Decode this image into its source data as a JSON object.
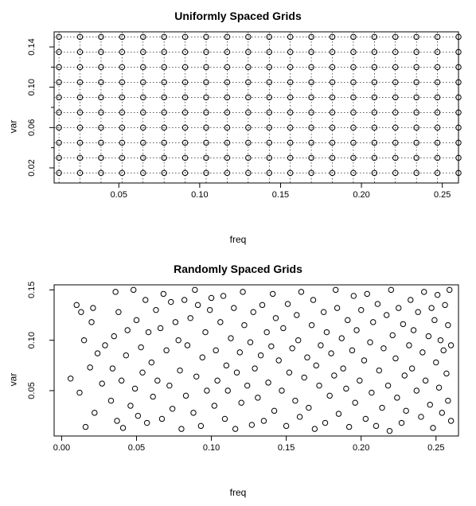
{
  "chart_data": [
    {
      "type": "scatter",
      "title": "Uniformly Spaced Grids",
      "xlabel": "freq",
      "ylabel": "var",
      "xlim": [
        0.01,
        0.26
      ],
      "ylim": [
        0.005,
        0.155
      ],
      "xticks": [
        0.05,
        0.1,
        0.15,
        0.2,
        0.25
      ],
      "yticks_major": [
        0.02,
        0.06,
        0.1,
        0.14
      ],
      "yticks_minor": [
        0.04,
        0.08,
        0.12
      ],
      "grid_x_values": [
        0.013,
        0.026,
        0.039,
        0.052,
        0.065,
        0.078,
        0.091,
        0.104,
        0.117,
        0.13,
        0.143,
        0.156,
        0.169,
        0.182,
        0.195,
        0.208,
        0.221,
        0.234,
        0.247,
        0.26
      ],
      "grid_y_values": [
        0.015,
        0.03,
        0.045,
        0.06,
        0.075,
        0.09,
        0.105,
        0.12,
        0.135,
        0.15
      ],
      "grid": true,
      "note": "points are the full Cartesian product of grid_x_values × grid_y_values (200 points)"
    },
    {
      "type": "scatter",
      "title": "Randomly Spaced Grids",
      "xlabel": "freq",
      "ylabel": "var",
      "xlim": [
        -0.005,
        0.265
      ],
      "ylim": [
        0.005,
        0.155
      ],
      "xticks": [
        0.0,
        0.05,
        0.1,
        0.15,
        0.2,
        0.25
      ],
      "yticks_major": [
        0.05,
        0.1,
        0.15
      ],
      "grid": false,
      "points": [
        [
          0.006,
          0.062
        ],
        [
          0.01,
          0.135
        ],
        [
          0.012,
          0.048
        ],
        [
          0.013,
          0.128
        ],
        [
          0.015,
          0.1
        ],
        [
          0.016,
          0.014
        ],
        [
          0.019,
          0.073
        ],
        [
          0.02,
          0.118
        ],
        [
          0.021,
          0.132
        ],
        [
          0.022,
          0.028
        ],
        [
          0.024,
          0.087
        ],
        [
          0.027,
          0.057
        ],
        [
          0.029,
          0.095
        ],
        [
          0.033,
          0.04
        ],
        [
          0.034,
          0.072
        ],
        [
          0.035,
          0.104
        ],
        [
          0.036,
          0.148
        ],
        [
          0.037,
          0.02
        ],
        [
          0.038,
          0.128
        ],
        [
          0.04,
          0.06
        ],
        [
          0.041,
          0.013
        ],
        [
          0.043,
          0.085
        ],
        [
          0.044,
          0.11
        ],
        [
          0.046,
          0.035
        ],
        [
          0.048,
          0.15
        ],
        [
          0.049,
          0.052
        ],
        [
          0.05,
          0.12
        ],
        [
          0.051,
          0.025
        ],
        [
          0.053,
          0.093
        ],
        [
          0.054,
          0.068
        ],
        [
          0.056,
          0.14
        ],
        [
          0.057,
          0.018
        ],
        [
          0.058,
          0.108
        ],
        [
          0.06,
          0.078
        ],
        [
          0.061,
          0.044
        ],
        [
          0.063,
          0.13
        ],
        [
          0.064,
          0.06
        ],
        [
          0.066,
          0.112
        ],
        [
          0.067,
          0.022
        ],
        [
          0.068,
          0.146
        ],
        [
          0.07,
          0.09
        ],
        [
          0.072,
          0.055
        ],
        [
          0.073,
          0.138
        ],
        [
          0.074,
          0.032
        ],
        [
          0.076,
          0.118
        ],
        [
          0.078,
          0.1
        ],
        [
          0.079,
          0.07
        ],
        [
          0.08,
          0.012
        ],
        [
          0.082,
          0.14
        ],
        [
          0.083,
          0.045
        ],
        [
          0.084,
          0.095
        ],
        [
          0.086,
          0.122
        ],
        [
          0.088,
          0.028
        ],
        [
          0.089,
          0.15
        ],
        [
          0.09,
          0.064
        ],
        [
          0.091,
          0.135
        ],
        [
          0.093,
          0.015
        ],
        [
          0.094,
          0.083
        ],
        [
          0.096,
          0.108
        ],
        [
          0.097,
          0.05
        ],
        [
          0.099,
          0.13
        ],
        [
          0.1,
          0.142
        ],
        [
          0.102,
          0.035
        ],
        [
          0.103,
          0.09
        ],
        [
          0.104,
          0.06
        ],
        [
          0.106,
          0.118
        ],
        [
          0.108,
          0.144
        ],
        [
          0.109,
          0.022
        ],
        [
          0.11,
          0.075
        ],
        [
          0.111,
          0.05
        ],
        [
          0.113,
          0.102
        ],
        [
          0.115,
          0.132
        ],
        [
          0.116,
          0.012
        ],
        [
          0.117,
          0.068
        ],
        [
          0.119,
          0.088
        ],
        [
          0.12,
          0.038
        ],
        [
          0.121,
          0.148
        ],
        [
          0.122,
          0.115
        ],
        [
          0.124,
          0.055
        ],
        [
          0.126,
          0.098
        ],
        [
          0.127,
          0.016
        ],
        [
          0.128,
          0.128
        ],
        [
          0.129,
          0.072
        ],
        [
          0.131,
          0.043
        ],
        [
          0.133,
          0.085
        ],
        [
          0.134,
          0.135
        ],
        [
          0.135,
          0.02
        ],
        [
          0.137,
          0.108
        ],
        [
          0.138,
          0.058
        ],
        [
          0.14,
          0.094
        ],
        [
          0.141,
          0.146
        ],
        [
          0.142,
          0.03
        ],
        [
          0.143,
          0.122
        ],
        [
          0.145,
          0.08
        ],
        [
          0.147,
          0.05
        ],
        [
          0.148,
          0.112
        ],
        [
          0.15,
          0.015
        ],
        [
          0.151,
          0.136
        ],
        [
          0.152,
          0.068
        ],
        [
          0.154,
          0.092
        ],
        [
          0.156,
          0.04
        ],
        [
          0.157,
          0.125
        ],
        [
          0.158,
          0.1
        ],
        [
          0.159,
          0.024
        ],
        [
          0.16,
          0.148
        ],
        [
          0.162,
          0.063
        ],
        [
          0.164,
          0.083
        ],
        [
          0.165,
          0.033
        ],
        [
          0.167,
          0.115
        ],
        [
          0.168,
          0.14
        ],
        [
          0.169,
          0.012
        ],
        [
          0.17,
          0.075
        ],
        [
          0.172,
          0.055
        ],
        [
          0.173,
          0.095
        ],
        [
          0.175,
          0.128
        ],
        [
          0.176,
          0.018
        ],
        [
          0.177,
          0.108
        ],
        [
          0.179,
          0.045
        ],
        [
          0.18,
          0.087
        ],
        [
          0.182,
          0.065
        ],
        [
          0.183,
          0.15
        ],
        [
          0.184,
          0.132
        ],
        [
          0.185,
          0.027
        ],
        [
          0.187,
          0.102
        ],
        [
          0.188,
          0.072
        ],
        [
          0.19,
          0.052
        ],
        [
          0.191,
          0.12
        ],
        [
          0.192,
          0.014
        ],
        [
          0.194,
          0.09
        ],
        [
          0.195,
          0.144
        ],
        [
          0.196,
          0.038
        ],
        [
          0.197,
          0.11
        ],
        [
          0.199,
          0.06
        ],
        [
          0.2,
          0.13
        ],
        [
          0.202,
          0.08
        ],
        [
          0.203,
          0.022
        ],
        [
          0.204,
          0.146
        ],
        [
          0.206,
          0.098
        ],
        [
          0.207,
          0.048
        ],
        [
          0.208,
          0.118
        ],
        [
          0.21,
          0.015
        ],
        [
          0.211,
          0.136
        ],
        [
          0.212,
          0.07
        ],
        [
          0.214,
          0.033
        ],
        [
          0.215,
          0.092
        ],
        [
          0.217,
          0.125
        ],
        [
          0.218,
          0.055
        ],
        [
          0.219,
          0.01
        ],
        [
          0.22,
          0.15
        ],
        [
          0.221,
          0.105
        ],
        [
          0.223,
          0.082
        ],
        [
          0.224,
          0.043
        ],
        [
          0.225,
          0.132
        ],
        [
          0.227,
          0.018
        ],
        [
          0.228,
          0.116
        ],
        [
          0.229,
          0.065
        ],
        [
          0.23,
          0.03
        ],
        [
          0.232,
          0.095
        ],
        [
          0.233,
          0.14
        ],
        [
          0.234,
          0.072
        ],
        [
          0.235,
          0.11
        ],
        [
          0.237,
          0.05
        ],
        [
          0.238,
          0.128
        ],
        [
          0.24,
          0.024
        ],
        [
          0.241,
          0.088
        ],
        [
          0.242,
          0.148
        ],
        [
          0.243,
          0.06
        ],
        [
          0.245,
          0.104
        ],
        [
          0.246,
          0.036
        ],
        [
          0.247,
          0.132
        ],
        [
          0.248,
          0.013
        ],
        [
          0.249,
          0.12
        ],
        [
          0.25,
          0.078
        ],
        [
          0.251,
          0.145
        ],
        [
          0.252,
          0.053
        ],
        [
          0.253,
          0.1
        ],
        [
          0.254,
          0.028
        ],
        [
          0.255,
          0.09
        ],
        [
          0.256,
          0.135
        ],
        [
          0.257,
          0.067
        ],
        [
          0.258,
          0.115
        ],
        [
          0.258,
          0.04
        ],
        [
          0.259,
          0.15
        ],
        [
          0.26,
          0.02
        ],
        [
          0.26,
          0.095
        ]
      ]
    }
  ]
}
